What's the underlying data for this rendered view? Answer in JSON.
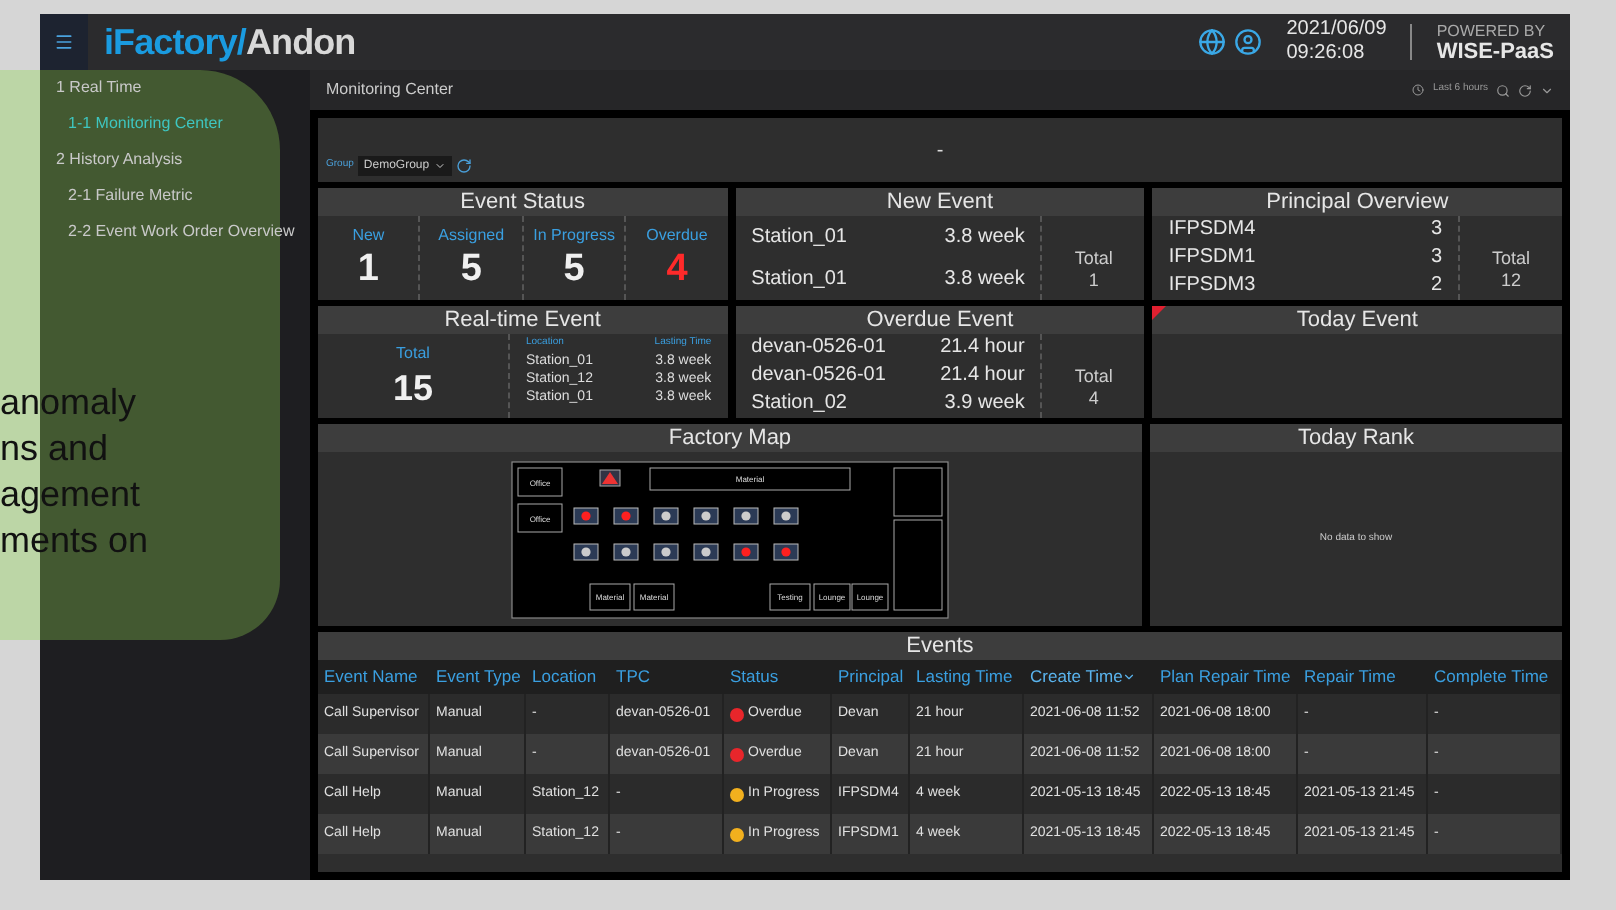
{
  "header": {
    "brand": "iFactory/",
    "product": "Andon",
    "date": "2021/06/09",
    "time": "09:26:08",
    "powered_by": "POWERED BY",
    "platform": "WISE-PaaS"
  },
  "sidebar": {
    "items": [
      {
        "label": "1 Real Time",
        "selected": false,
        "children": [
          {
            "label": "1-1 Monitoring Center",
            "selected": true
          }
        ]
      },
      {
        "label": "2 History Analysis",
        "selected": false,
        "children": [
          {
            "label": "2-1 Failure Metric",
            "selected": false
          },
          {
            "label": "2-2 Event Work Order Overview",
            "selected": false
          }
        ]
      }
    ]
  },
  "overlay": {
    "lines": [
      "anomaly",
      "ns and",
      "agement",
      "ments on"
    ]
  },
  "page": {
    "title": "Monitoring Center",
    "time_range": "Last 6 hours",
    "banner": "-",
    "group_label": "Group",
    "group_value": "DemoGroup"
  },
  "event_status": {
    "title": "Event Status",
    "items": [
      {
        "label": "New",
        "value": "1",
        "kind": "normal"
      },
      {
        "label": "Assigned",
        "value": "5",
        "kind": "normal"
      },
      {
        "label": "In Progress",
        "value": "5",
        "kind": "normal"
      },
      {
        "label": "Overdue",
        "value": "4",
        "kind": "alert"
      }
    ]
  },
  "new_event": {
    "title": "New Event",
    "rows": [
      {
        "name": "Station_01",
        "time": "3.8 week"
      },
      {
        "name": "Station_01",
        "time": "3.8 week"
      }
    ],
    "total_label": "Total",
    "total": "1"
  },
  "principal_overview": {
    "title": "Principal Overview",
    "rows": [
      {
        "name": "IFPSDM4",
        "count": "3"
      },
      {
        "name": "IFPSDM1",
        "count": "3"
      },
      {
        "name": "IFPSDM3",
        "count": "2"
      }
    ],
    "total_label": "Total",
    "total": "12"
  },
  "realtime_event": {
    "title": "Real-time Event",
    "total_label": "Total",
    "total": "15",
    "col_location": "Location",
    "col_time": "Lasting Time",
    "rows": [
      {
        "name": "Station_01",
        "time": "3.8 week"
      },
      {
        "name": "Station_12",
        "time": "3.8 week"
      },
      {
        "name": "Station_01",
        "time": "3.8 week"
      }
    ]
  },
  "overdue_event": {
    "title": "Overdue Event",
    "rows": [
      {
        "name": "devan-0526-01",
        "time": "21.4 hour"
      },
      {
        "name": "devan-0526-01",
        "time": "21.4 hour"
      },
      {
        "name": "Station_02",
        "time": "3.9 week"
      }
    ],
    "total_label": "Total",
    "total": "4"
  },
  "today_event": {
    "title": "Today Event"
  },
  "factory_map": {
    "title": "Factory Map",
    "rooms": [
      "Office",
      "Office",
      "Material",
      "Material",
      "Material",
      "Testing",
      "Lounge",
      "Lounge"
    ],
    "stations": [
      {
        "alarm": true
      },
      {
        "alarm": true
      },
      {
        "alarm": false
      },
      {
        "alarm": false
      },
      {
        "alarm": false
      },
      {
        "alarm": false
      },
      {
        "alarm": false
      },
      {
        "alarm": false
      },
      {
        "alarm": false
      },
      {
        "alarm": false
      },
      {
        "alarm": true
      },
      {
        "alarm": true
      }
    ]
  },
  "today_rank": {
    "title": "Today Rank",
    "empty": "No data to show"
  },
  "events": {
    "title": "Events",
    "columns": [
      {
        "label": "Event Name",
        "sorted": false
      },
      {
        "label": "Event Type",
        "sorted": false
      },
      {
        "label": "Location",
        "sorted": false
      },
      {
        "label": "TPC",
        "sorted": false
      },
      {
        "label": "Status",
        "sorted": false
      },
      {
        "label": "Principal",
        "sorted": false
      },
      {
        "label": "Lasting Time",
        "sorted": false
      },
      {
        "label": "Create Time",
        "sorted": true
      },
      {
        "label": "Plan Repair Time",
        "sorted": false
      },
      {
        "label": "Repair Time",
        "sorted": false
      },
      {
        "label": "Complete Time",
        "sorted": false
      }
    ],
    "rows": [
      {
        "cells": [
          "Call Supervisor",
          "Manual",
          "-",
          "devan-0526-01",
          "Overdue",
          "Devan",
          "21 hour",
          "2021-06-08 11:52",
          "2021-06-08 18:00",
          "-",
          "-"
        ],
        "color": "#e8262b"
      },
      {
        "cells": [
          "Call Supervisor",
          "Manual",
          "-",
          "devan-0526-01",
          "Overdue",
          "Devan",
          "21 hour",
          "2021-06-08 11:52",
          "2021-06-08 18:00",
          "-",
          "-"
        ],
        "color": "#e8262b"
      },
      {
        "cells": [
          "Call Help",
          "Manual",
          "Station_12",
          "-",
          "In Progress",
          "IFPSDM4",
          "4 week",
          "2021-05-13 18:45",
          "2022-05-13 18:45",
          "2021-05-13 21:45",
          "-"
        ],
        "color": "#f2b01e"
      },
      {
        "cells": [
          "Call Help",
          "Manual",
          "Station_12",
          "-",
          "In Progress",
          "IFPSDM1",
          "4 week",
          "2021-05-13 18:45",
          "2022-05-13 18:45",
          "2021-05-13 21:45",
          "-"
        ],
        "color": "#f2b01e"
      }
    ]
  }
}
